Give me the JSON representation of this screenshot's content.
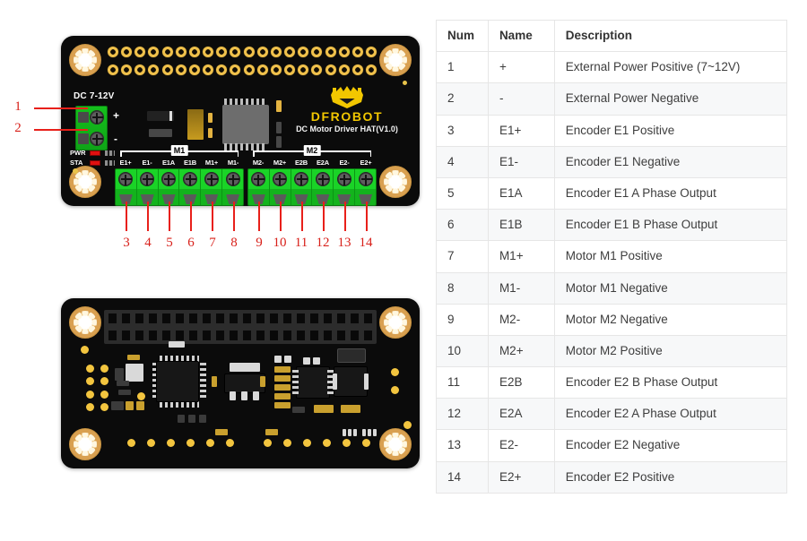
{
  "table": {
    "headers": [
      "Num",
      "Name",
      "Description"
    ],
    "rows": [
      {
        "num": "1",
        "name": "+",
        "desc": "External Power Positive (7~12V)"
      },
      {
        "num": "2",
        "name": "-",
        "desc": "External Power Negative"
      },
      {
        "num": "3",
        "name": "E1+",
        "desc": "Encoder E1 Positive"
      },
      {
        "num": "4",
        "name": "E1-",
        "desc": "Encoder E1 Negative"
      },
      {
        "num": "5",
        "name": "E1A",
        "desc": "Encoder E1 A Phase Output"
      },
      {
        "num": "6",
        "name": "E1B",
        "desc": "Encoder E1 B Phase Output"
      },
      {
        "num": "7",
        "name": "M1+",
        "desc": "Motor M1 Positive"
      },
      {
        "num": "8",
        "name": "M1-",
        "desc": "Motor M1 Negative"
      },
      {
        "num": "9",
        "name": "M2-",
        "desc": "Motor M2 Negative"
      },
      {
        "num": "10",
        "name": "M2+",
        "desc": "Motor M2 Positive"
      },
      {
        "num": "11",
        "name": "E2B",
        "desc": "Encoder E2 B Phase Output"
      },
      {
        "num": "12",
        "name": "E2A",
        "desc": "Encoder E2 A Phase Output"
      },
      {
        "num": "13",
        "name": "E2-",
        "desc": "Encoder E2 Negative"
      },
      {
        "num": "14",
        "name": "E2+",
        "desc": "Encoder E2 Positive"
      }
    ]
  },
  "board_front": {
    "power_label": "DC 7-12V",
    "power_plus": "+",
    "power_minus": "-",
    "brand_name": "DFROBOT",
    "brand_sub": "DC Motor Driver HAT(V1.0)",
    "led_pwr": "PWR",
    "led_sta": "STA",
    "group_m1": "M1",
    "group_m2": "M2",
    "m1_pins": [
      "E1+",
      "E1-",
      "E1A",
      "E1B",
      "M1+",
      "M1-"
    ],
    "m2_pins": [
      "M2-",
      "M2+",
      "E2B",
      "E2A",
      "E2-",
      "E2+"
    ],
    "callout_left": [
      "1",
      "2"
    ],
    "callout_bottom": [
      "3",
      "4",
      "5",
      "6",
      "7",
      "8",
      "9",
      "10",
      "11",
      "12",
      "13",
      "14"
    ]
  },
  "colors": {
    "pcb_black": "#0b0b0b",
    "terminal_green": "#1ad327",
    "gold": "#f0c14b",
    "brand_yellow": "#f2c700",
    "callout_red": "#e8201a",
    "table_border": "#e6e6e6",
    "table_stripe": "#f7f8f9",
    "table_text": "#3d3d3d"
  }
}
